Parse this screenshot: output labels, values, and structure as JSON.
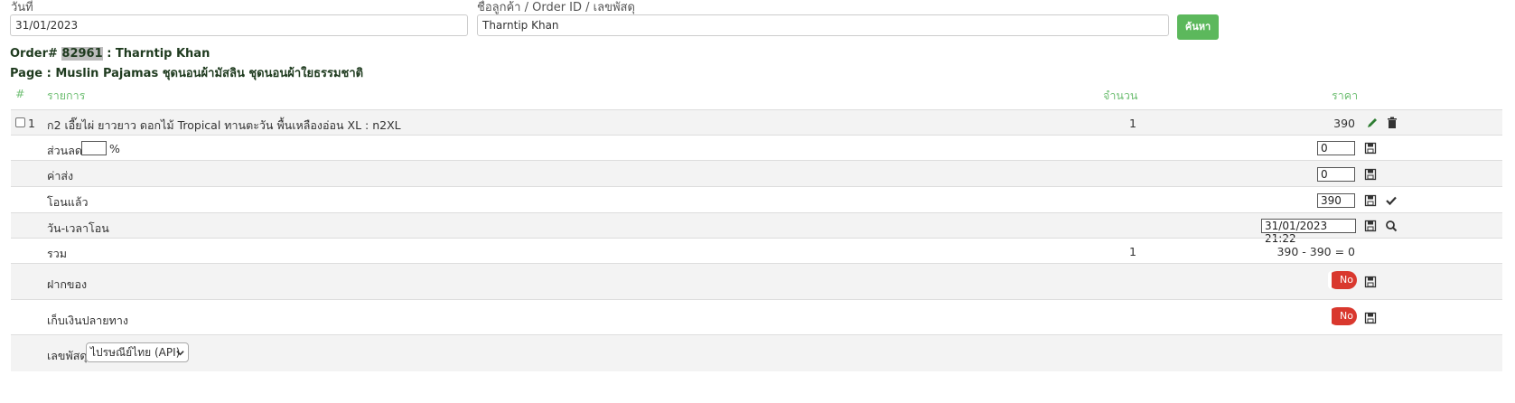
{
  "search": {
    "date_label": "วันที่",
    "date_value": "31/01/2023",
    "customer_label": "ชื่อลูกค้า / Order ID / เลขพัสดุ",
    "customer_value": "Tharntip Khan",
    "button_label": "ค้นหา"
  },
  "order": {
    "prefix": "Order#",
    "id": "82961",
    "customer_suffix": ": Tharntip Khan",
    "page_line": "Page : Muslin Pajamas ชุดนอนผ้ามัสลิน ชุดนอนผ้าใยธรรมชาติ"
  },
  "table": {
    "headers": {
      "num": "#",
      "item": "รายการ",
      "qty": "จำนวน",
      "price": "ราคา"
    },
    "items": [
      {
        "index": "1",
        "name": "ก2 เอี๊ยไผ่ ยาวยาว ดอกไม้ Tropical ทานตะวัน พื้นเหลืองอ่อน XL : n2XL",
        "qty": "1",
        "price": "390"
      }
    ],
    "discount": {
      "label": "ส่วนลด",
      "percent_value": "",
      "percent_sign": "%",
      "value": "0"
    },
    "shipping": {
      "label": "ค่าส่ง",
      "value": "0"
    },
    "paid": {
      "label": "โอนแล้ว",
      "value": "390"
    },
    "transfer_time": {
      "label": "วัน-เวลาโอน",
      "value": "31/01/2023 21:22"
    },
    "total": {
      "label": "รวม",
      "qty": "1",
      "formula": "390 - 390 = 0"
    },
    "deposit": {
      "label": "ฝากของ",
      "toggle": "No"
    },
    "cod": {
      "label": "เก็บเงินปลายทาง",
      "toggle": "No"
    },
    "tracking": {
      "label": "เลขพัสดุ",
      "carrier_selected": "ไปรษณีย์ไทย (API)"
    }
  }
}
